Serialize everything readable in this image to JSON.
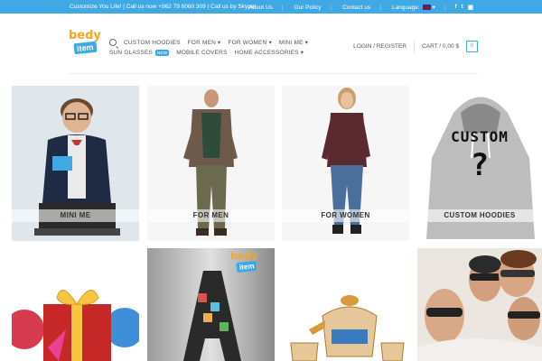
{
  "topbar": {
    "left_text": "Customize You Life! | Call us now +962 79 6060 309 | Call us by Skype!",
    "links": [
      "About Us",
      "Our Policy",
      "Contact us"
    ],
    "language_label": "Language:",
    "social_icons": [
      "facebook-icon",
      "twitter-icon",
      "instagram-icon"
    ],
    "social_glyphs": [
      "f",
      "t",
      "▣"
    ]
  },
  "logo": {
    "line1": "bedy",
    "line2": "item"
  },
  "nav": {
    "row1": [
      "CUSTOM HOODIES",
      "FOR MEN ▾",
      "FOR WOMEN ▾",
      "MINI ME ▾"
    ],
    "row2": [
      "SUN GLASSES",
      "MOBILE COVERS",
      "HOME ACCESSORIES ▾"
    ],
    "new_badge": "NEW"
  },
  "account": {
    "login": "LOGIN / REGISTER",
    "cart": "CART / 0,00 $",
    "cart_count": "0"
  },
  "categories": [
    {
      "label": "MINI ME"
    },
    {
      "label": "FOR MEN"
    },
    {
      "label": "FOR WOMEN"
    },
    {
      "label": "CUSTOM HOODIES"
    }
  ],
  "hoodie_text": {
    "line1": "CUSTOM",
    "line2": "?"
  },
  "colors": {
    "accent": "#3fa9e6",
    "logo_orange": "#f5a623"
  }
}
